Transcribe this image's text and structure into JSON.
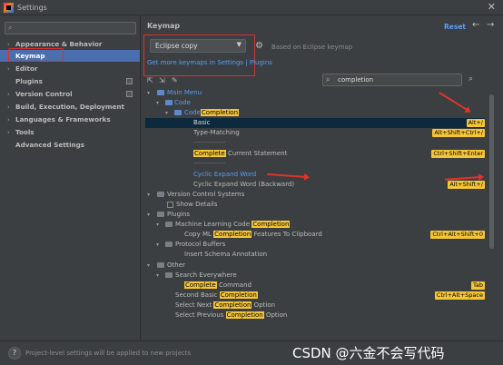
{
  "window": {
    "title": "Settings",
    "close_glyph": "✕"
  },
  "sidebar": {
    "search_placeholder": "",
    "items": [
      {
        "label": "Appearance & Behavior",
        "arrow": "›"
      },
      {
        "label": "Keymap",
        "selected": true
      },
      {
        "label": "Editor",
        "arrow": "›"
      },
      {
        "label": "Plugins"
      },
      {
        "label": "Version Control",
        "arrow": "›"
      },
      {
        "label": "Build, Execution, Deployment",
        "arrow": "›"
      },
      {
        "label": "Languages & Frameworks",
        "arrow": "›"
      },
      {
        "label": "Tools",
        "arrow": "›"
      },
      {
        "label": "Advanced Settings"
      }
    ]
  },
  "main": {
    "title": "Keymap",
    "reset": "Reset",
    "back": "←",
    "forward": "→",
    "keymap_value": "Eclipse copy",
    "based_on": "Based on Eclipse keymap",
    "more_link": "Get more keymaps in Settings | Plugins",
    "filter_value": "completion",
    "find_glyph": "⌕"
  },
  "tree": {
    "main_menu": "Main Menu",
    "code": "Code",
    "code_completion_prefix": "Code",
    "code_completion_hl": "Completion",
    "basic": "Basic",
    "basic_sc": "Alt+/",
    "type_matching": "Type-Matching",
    "type_matching_sc": "Alt+Shift+Ctrl+/",
    "separator": "--------------",
    "complete_hl": "Complete",
    "current_statement": " Current Statement",
    "current_statement_sc": "Ctrl+Shift+Enter",
    "separator2": "--------------",
    "cyclic_expand": "Cyclic Expand Word",
    "cyclic_expand_back": "Cyclic Expand Word (Backward)",
    "cyclic_expand_back_sc": "Alt+Shift+/",
    "vcs": "Version Control Systems",
    "show_details": "Show Details",
    "plugins": "Plugins",
    "ml_prefix": "Machine Learning Code ",
    "ml_hl": "Completion",
    "copy_ml_prefix": "Copy ML ",
    "copy_ml_hl": "Completion",
    "copy_ml_suffix": " Features To Clipboard",
    "copy_ml_sc": "Ctrl+Alt+Shift+0",
    "protocol_buffers": "Protocol Buffers",
    "insert_schema": "Insert Schema Annotation",
    "other": "Other",
    "search_everywhere": "Search Everywhere",
    "complete_command_hl": "Complete",
    "complete_command": " Command",
    "complete_command_sc": "Tab",
    "second_basic_prefix": "Second Basic ",
    "second_basic_hl": "Completion",
    "second_basic_sc": "Ctrl+Alt+Space",
    "select_next_prefix": "Select Next ",
    "select_next_hl": "Completion",
    "select_next_suffix": " Option",
    "select_prev_prefix": "Select Previous ",
    "select_prev_hl": "Completion",
    "select_prev_suffix": " Option"
  },
  "footer": {
    "help": "?",
    "hint": "Project-level settings will be applied to new projects",
    "watermark": "CSDN @六金不会写代码"
  },
  "colors": {
    "accent_blue": "#4b6eaf",
    "highlight_yellow": "#f4c537",
    "annotation_red": "#d9302c",
    "link_blue": "#589df6"
  }
}
